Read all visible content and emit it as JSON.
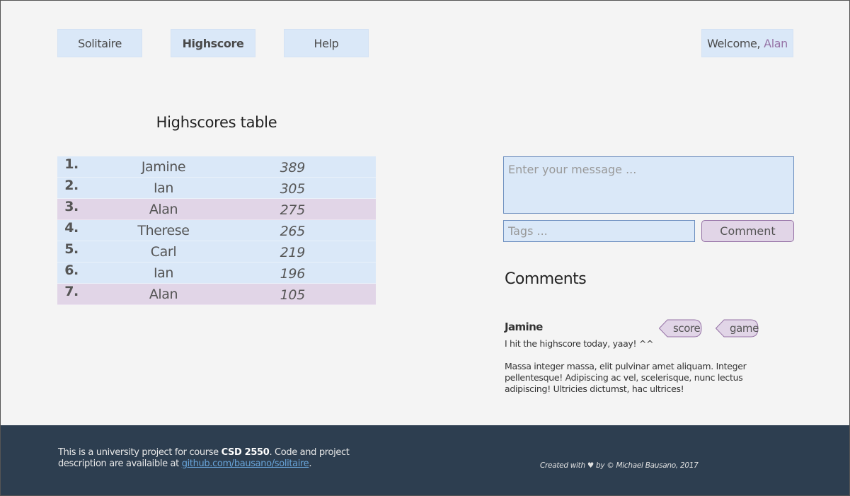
{
  "nav": {
    "solitaire": "Solitaire",
    "highscore": "Highscore",
    "help": "Help",
    "welcome_prefix": "Welcome,",
    "username": "Alan"
  },
  "highscores": {
    "title": "Highscores table",
    "rows": [
      {
        "rank": "1.",
        "name": "Jamine",
        "score": "389",
        "is_current_user": false
      },
      {
        "rank": "2.",
        "name": "Ian",
        "score": "305",
        "is_current_user": false
      },
      {
        "rank": "3.",
        "name": "Alan",
        "score": "275",
        "is_current_user": true
      },
      {
        "rank": "4.",
        "name": "Therese",
        "score": "265",
        "is_current_user": false
      },
      {
        "rank": "5.",
        "name": "Carl",
        "score": "219",
        "is_current_user": false
      },
      {
        "rank": "6.",
        "name": "Ian",
        "score": "196",
        "is_current_user": false
      },
      {
        "rank": "7.",
        "name": "Alan",
        "score": "105",
        "is_current_user": true
      }
    ]
  },
  "comment_form": {
    "message_placeholder": "Enter your message ...",
    "tags_placeholder": "Tags ...",
    "submit_label": "Comment"
  },
  "comments": {
    "title": "Comments",
    "items": [
      {
        "author": "Jamine",
        "tags": [
          "score",
          "game"
        ],
        "line1": "I hit the highscore today, yaay! ^^",
        "line2": "Massa integer massa, elit pulvinar amet aliquam. Integer pellentesque! Adipiscing ac vel, scelerisque, nunc lectus adipiscing! Ultricies dictumst, hac ultrices!"
      }
    ]
  },
  "footer": {
    "text_before": "This is a university project for course",
    "course": "CSD 2550",
    "text_after": ". Code and project description are availaible at",
    "link": "github.com/bausano/solitaire",
    "end": ".",
    "credit": "Created with ♥ by © Michael Bausano, 2017"
  },
  "colors": {
    "background": "#f4f4f4",
    "blue_fill": "#dae8f8",
    "blue_border": "#6c8ebf",
    "purple_fill": "#e1d5e7",
    "purple_border": "#9673a6",
    "footer_bg": "#2d3e50",
    "link": "#68a4d9"
  }
}
